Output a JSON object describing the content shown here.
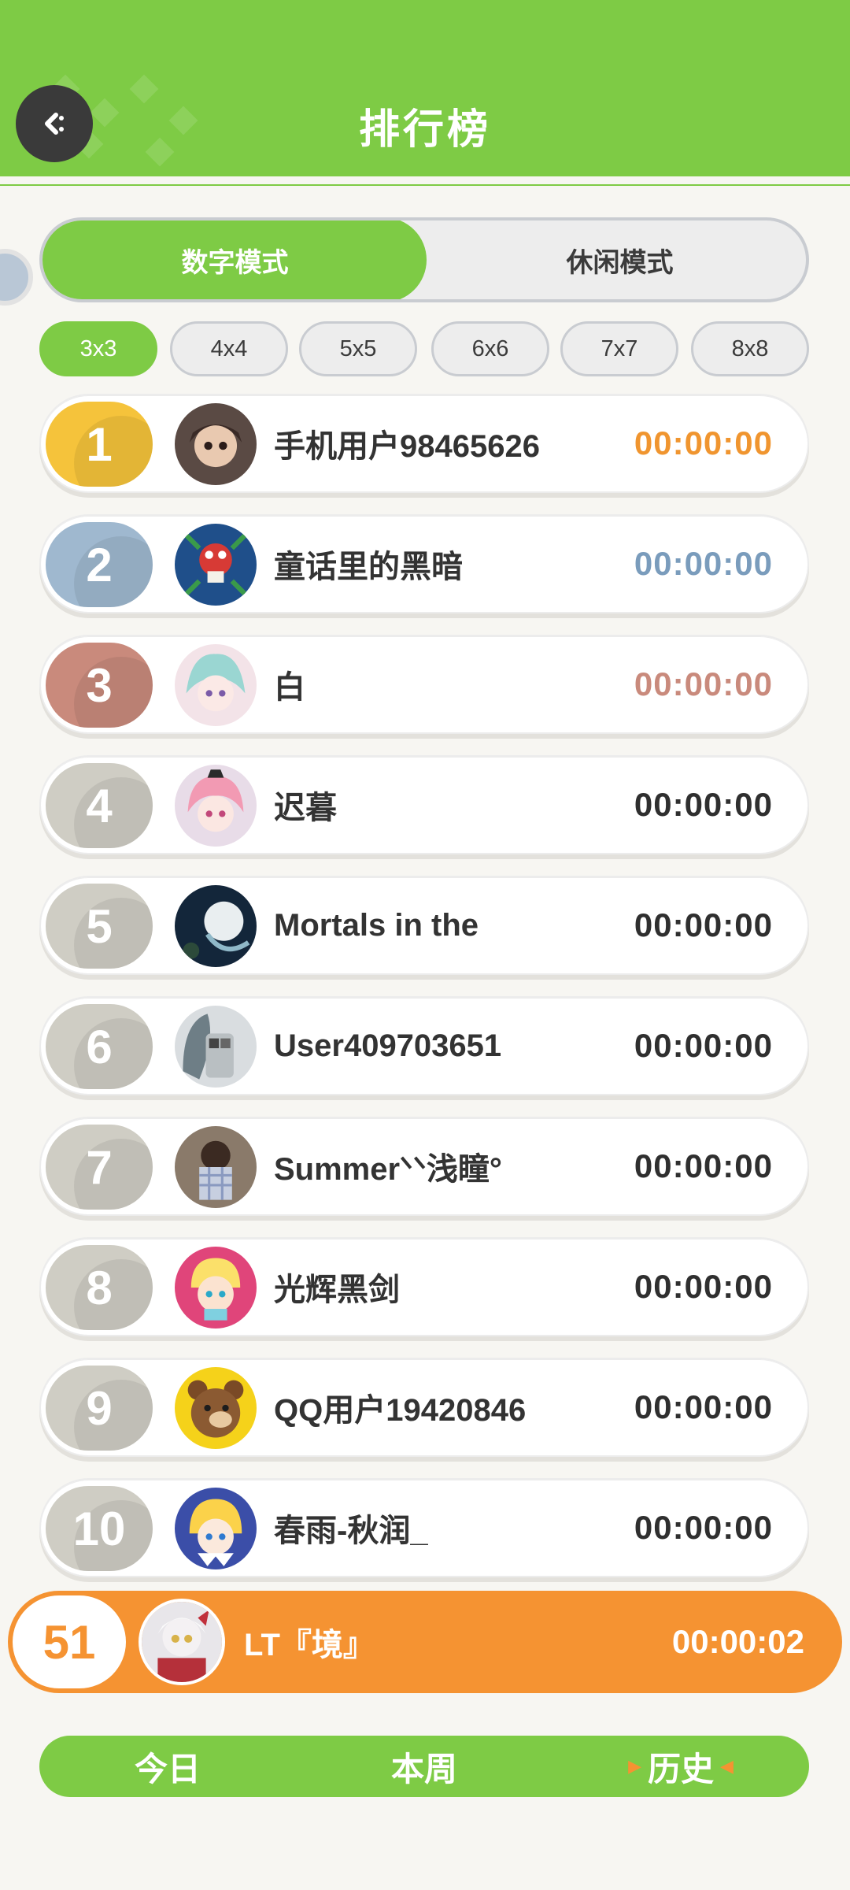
{
  "header": {
    "title": "排行榜"
  },
  "modes": [
    {
      "label": "数字模式",
      "active": true
    },
    {
      "label": "休闲模式",
      "active": false
    }
  ],
  "sizes": [
    "3x3",
    "4x4",
    "5x5",
    "6x6",
    "7x7",
    "8x8"
  ],
  "active_size": "3x3",
  "rankings": [
    {
      "rank": "1",
      "name": "手机用户98465626",
      "time": "00:00:00"
    },
    {
      "rank": "2",
      "name": "童话里的黑暗",
      "time": "00:00:00"
    },
    {
      "rank": "3",
      "name": "白",
      "time": "00:00:00"
    },
    {
      "rank": "4",
      "name": "迟暮",
      "time": "00:00:00"
    },
    {
      "rank": "5",
      "name": "Mortals in the",
      "time": "00:00:00"
    },
    {
      "rank": "6",
      "name": "User409703651",
      "time": "00:00:00"
    },
    {
      "rank": "7",
      "name": "Summerᐠᐠ浅瞳°",
      "time": "00:00:00"
    },
    {
      "rank": "8",
      "name": "光辉黑剑",
      "time": "00:00:00"
    },
    {
      "rank": "9",
      "name": "QQ用户19420846",
      "time": "00:00:00"
    },
    {
      "rank": "10",
      "name": "春雨-秋润_",
      "time": "00:00:00"
    }
  ],
  "me": {
    "rank": "51",
    "name": "LT『境』",
    "time": "00:00:02"
  },
  "periods": [
    {
      "label": "今日",
      "active": false
    },
    {
      "label": "本周",
      "active": false
    },
    {
      "label": "历史",
      "active": true
    }
  ],
  "colors": {
    "green": "#7ecb45",
    "orange": "#f59332",
    "gold": "#f5c33b",
    "silver": "#9fb8cf",
    "bronze": "#c98a7c",
    "gray_badge": "#cfcdc4",
    "time_gold": "#f0952f",
    "time_silver": "#7a9cbc",
    "time_bronze": "#c98a7c"
  },
  "icons": {
    "back": "back-arrow-icon"
  }
}
